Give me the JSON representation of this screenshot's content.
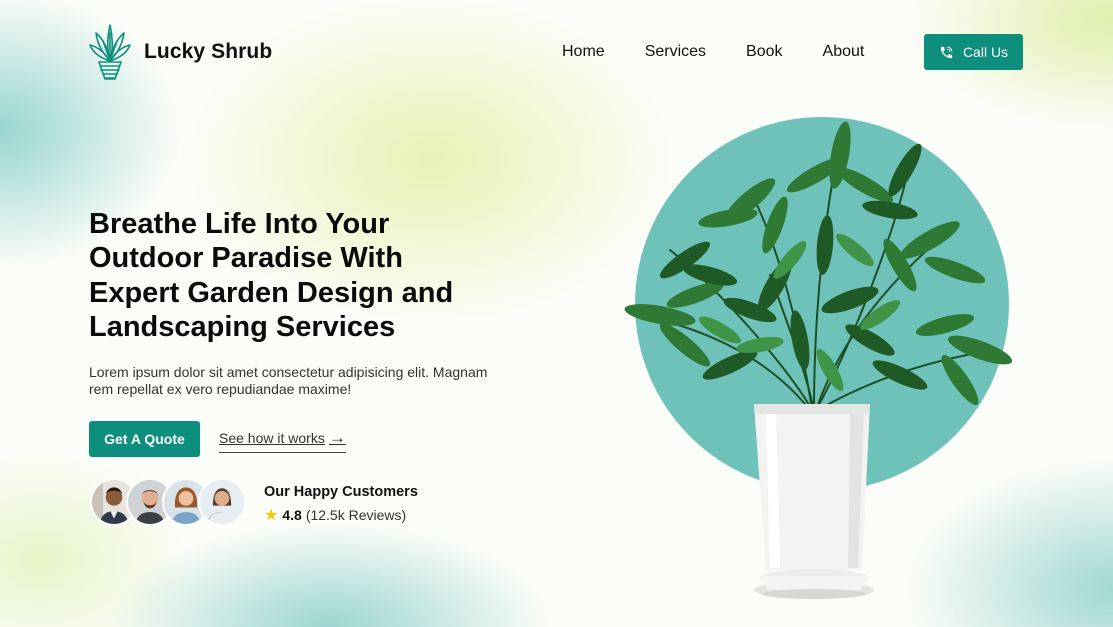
{
  "brand": {
    "name": "Lucky Shrub",
    "logo_icon": "plant-logo-icon"
  },
  "nav": {
    "items": [
      {
        "label": "Home"
      },
      {
        "label": "Services"
      },
      {
        "label": "Book"
      },
      {
        "label": "About"
      }
    ]
  },
  "call_button": {
    "label": "Call Us",
    "icon": "phone-icon"
  },
  "hero": {
    "title_lines": [
      "Breathe Life Into Your",
      "Outdoor Paradise With",
      "Expert Garden Design and",
      "Landscaping Services"
    ],
    "description_lines": [
      "Lorem ipsum dolor sit amet consectetur adipisicing elit. Magnam",
      "rem repellat ex vero repudiandae maxime!"
    ],
    "primary_cta": "Get A Quote",
    "secondary_cta": "See how it works",
    "secondary_cta_arrow": "→"
  },
  "customers": {
    "title": "Our Happy Customers",
    "rating": "4.8",
    "reviews": "(12.5k Reviews)",
    "star_icon": "star-icon"
  },
  "colors": {
    "accent": "#0e8f7e",
    "circle": "#6fc2ba",
    "star": "#f2c70c"
  }
}
